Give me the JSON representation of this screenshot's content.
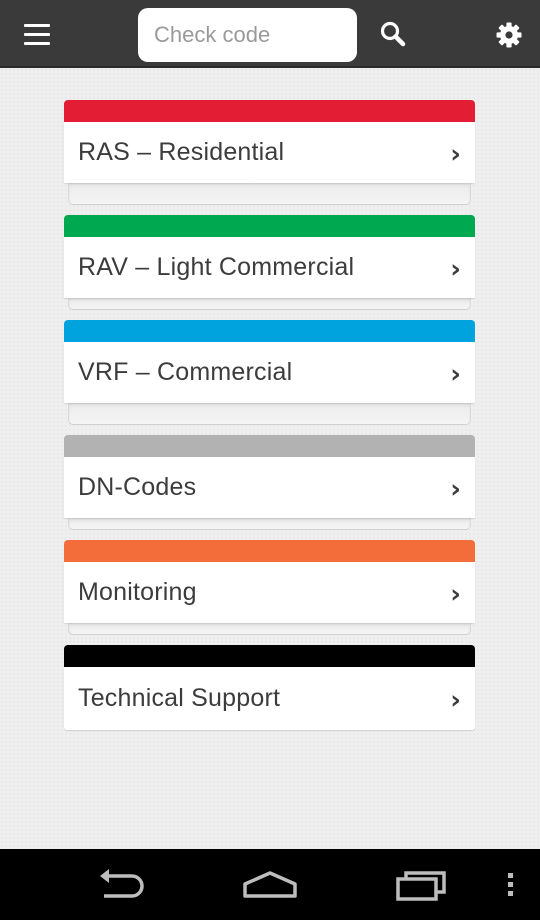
{
  "topbar": {
    "menu_icon": "hamburger-menu-icon",
    "search": {
      "placeholder": "Check code",
      "value": ""
    },
    "search_icon": "search-icon",
    "settings_icon": "gear-icon"
  },
  "menu": {
    "items": [
      {
        "label": "RAS – Residential",
        "color": "#e31e34"
      },
      {
        "label": "RAV – Light Commercial",
        "color": "#00a84f"
      },
      {
        "label": "VRF – Commercial",
        "color": "#00a3dd"
      },
      {
        "label": "DN-Codes",
        "color": "#b2b2b2"
      },
      {
        "label": "Monitoring",
        "color": "#f26d3a"
      },
      {
        "label": "Technical Support",
        "color": "#000000"
      }
    ],
    "chevron": "›"
  },
  "navbar": {
    "back_icon": "back-icon",
    "home_icon": "home-icon",
    "recents_icon": "recent-apps-icon",
    "overflow_icon": "overflow-menu-icon"
  }
}
